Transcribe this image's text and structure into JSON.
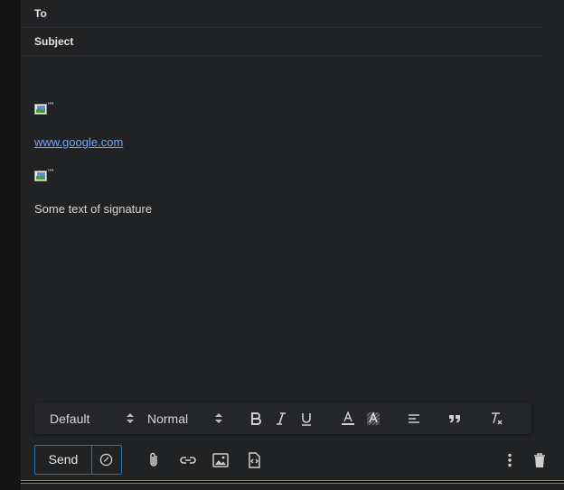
{
  "header": {
    "to_label": "To",
    "subject_label": "Subject"
  },
  "body": {
    "image1_alt": "\"\"",
    "link_text": "www.google.com",
    "image2_alt": "\"\"",
    "signature_text": "Some text of signature"
  },
  "format_toolbar": {
    "font_value": "Default",
    "size_value": "Normal",
    "icons": [
      "bold-icon",
      "italic-icon",
      "underline-icon",
      "text-color-icon",
      "highlight-color-icon",
      "align-icon",
      "quote-icon",
      "clear-formatting-icon"
    ]
  },
  "actions": {
    "send_label": "Send",
    "icons": [
      "schedule-send-icon",
      "attach-icon",
      "link-icon",
      "image-icon",
      "signature-icon",
      "more-options-icon",
      "trash-icon"
    ]
  },
  "colors": {
    "background": "#212224",
    "link": "#6ea6ff",
    "accent_border": "#2f6fb0"
  }
}
